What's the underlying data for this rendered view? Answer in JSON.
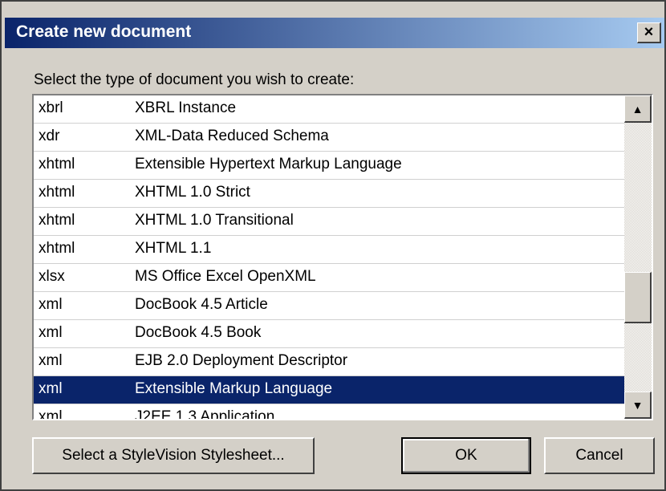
{
  "dialog": {
    "title": "Create new document",
    "close_label": "×",
    "prompt": "Select the type of document you wish to create:"
  },
  "list": {
    "rows": [
      {
        "ext": "xbrl",
        "desc": "XBRL Instance"
      },
      {
        "ext": "xdr",
        "desc": "XML-Data Reduced Schema"
      },
      {
        "ext": "xhtml",
        "desc": "Extensible Hypertext Markup Language"
      },
      {
        "ext": "xhtml",
        "desc": "XHTML 1.0 Strict"
      },
      {
        "ext": "xhtml",
        "desc": "XHTML 1.0 Transitional"
      },
      {
        "ext": "xhtml",
        "desc": "XHTML 1.1"
      },
      {
        "ext": "xlsx",
        "desc": "MS Office Excel OpenXML"
      },
      {
        "ext": "xml",
        "desc": "DocBook 4.5 Article"
      },
      {
        "ext": "xml",
        "desc": "DocBook 4.5 Book"
      },
      {
        "ext": "xml",
        "desc": "EJB 2.0 Deployment Descriptor"
      },
      {
        "ext": "xml",
        "desc": "Extensible Markup Language"
      },
      {
        "ext": "xml",
        "desc": "J2EE 1.3 Application"
      }
    ],
    "selected_index": 10
  },
  "scrollbar": {
    "up_icon": "▲",
    "down_icon": "▼"
  },
  "buttons": {
    "stylesheet": "Select a StyleVision Stylesheet...",
    "ok": "OK",
    "cancel": "Cancel"
  },
  "colors": {
    "title_bar_start": "#0a246a",
    "title_bar_end": "#a6caf0",
    "selection": "#0a246a",
    "dialog_bg": "#d4d0c8"
  }
}
